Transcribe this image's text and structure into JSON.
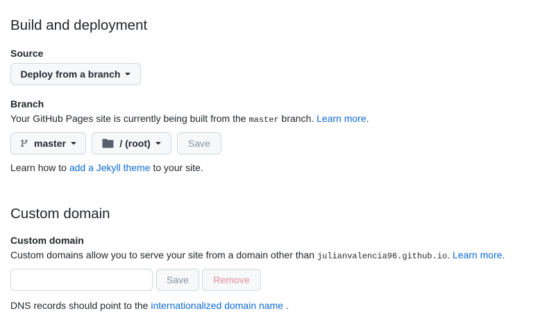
{
  "build": {
    "heading": "Build and deployment",
    "source_label": "Source",
    "source_button": "Deploy from a branch",
    "branch_label": "Branch",
    "branch_desc_pre": "Your GitHub Pages site is currently being built from the ",
    "branch_desc_code": "master",
    "branch_desc_post": " branch. ",
    "branch_desc_link": "Learn more",
    "branch_desc_end": ".",
    "branch_button": "master",
    "folder_button": "/ (root)",
    "save_button": "Save",
    "theme_pre": "Learn how to ",
    "theme_link": "add a Jekyll theme",
    "theme_post": " to your site."
  },
  "domain": {
    "heading": "Custom domain",
    "label": "Custom domain",
    "desc_pre": "Custom domains allow you to serve your site from a domain other than ",
    "desc_code": "julianvalencia96.github.io",
    "desc_post": ". ",
    "desc_link": "Learn more",
    "desc_end": ".",
    "input_value": "",
    "input_placeholder": "",
    "save_button": "Save",
    "remove_button": "Remove",
    "dns_pre": "DNS records should point to the ",
    "dns_link": "internationalized domain name",
    "dns_post": " ."
  },
  "icons": {
    "branch": "git-branch-icon",
    "folder": "folder-icon",
    "caret": "caret-down-icon"
  },
  "colors": {
    "link": "#0969da",
    "button_bg": "#f6f8fa",
    "border": "#d0d7de",
    "danger_disabled": "#e58d95"
  }
}
